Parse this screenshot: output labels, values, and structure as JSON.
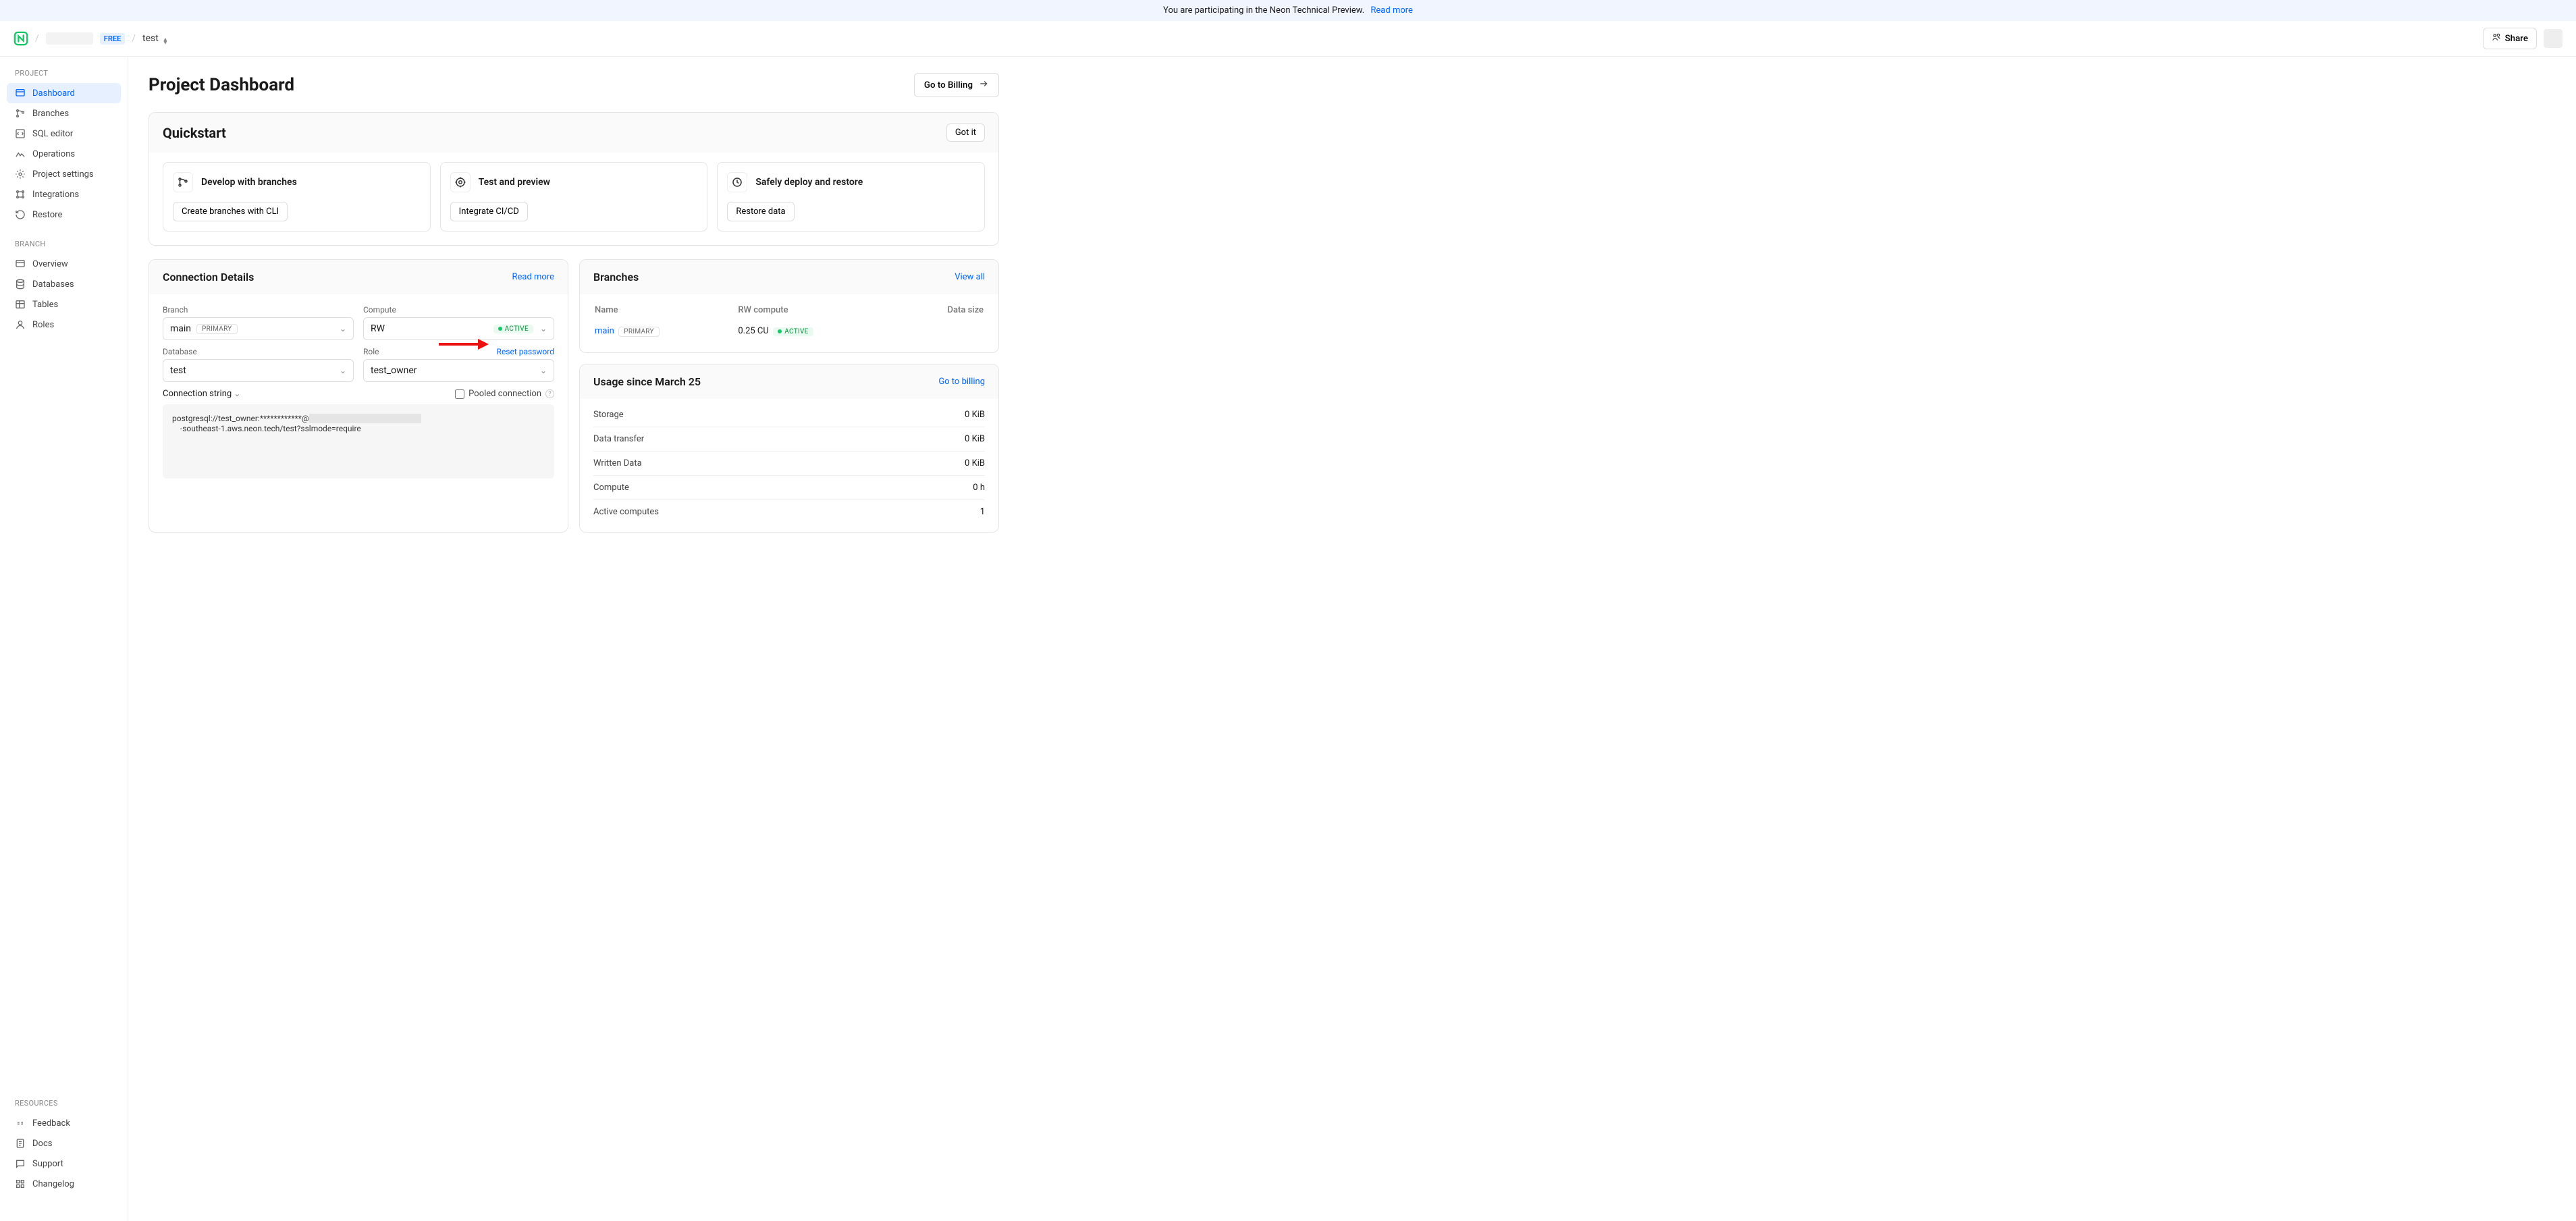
{
  "banner": {
    "text": "You are participating in the Neon Technical Preview.",
    "link": "Read more"
  },
  "topbar": {
    "free": "FREE",
    "project": "test",
    "share": "Share"
  },
  "sidebar": {
    "groups": {
      "project": {
        "label": "PROJECT",
        "items": [
          "Dashboard",
          "Branches",
          "SQL editor",
          "Operations",
          "Project settings",
          "Integrations",
          "Restore"
        ]
      },
      "branch": {
        "label": "BRANCH",
        "items": [
          "Overview",
          "Databases",
          "Tables",
          "Roles"
        ]
      },
      "resources": {
        "label": "RESOURCES",
        "items": [
          "Feedback",
          "Docs",
          "Support",
          "Changelog"
        ]
      }
    }
  },
  "page": {
    "title": "Project Dashboard",
    "billing_btn": "Go to Billing"
  },
  "quickstart": {
    "title": "Quickstart",
    "gotit": "Got it",
    "cards": [
      {
        "title": "Develop with branches",
        "btn": "Create branches with CLI"
      },
      {
        "title": "Test and preview",
        "btn": "Integrate CI/CD"
      },
      {
        "title": "Safely deploy and restore",
        "btn": "Restore data"
      }
    ]
  },
  "conn": {
    "title": "Connection Details",
    "read_more": "Read more",
    "labels": {
      "branch": "Branch",
      "compute": "Compute",
      "database": "Database",
      "role": "Role"
    },
    "branch": {
      "value": "main",
      "badge": "PRIMARY"
    },
    "compute": {
      "value": "RW",
      "badge": "ACTIVE"
    },
    "database": {
      "value": "test"
    },
    "role": {
      "value": "test_owner",
      "reset": "Reset password"
    },
    "cs_label": "Connection string",
    "pooled": "Pooled connection",
    "code_pre": "postgresql://test_owner:************@",
    "code_post": "\n    -southeast-1.aws.neon.tech/test?sslmode=require"
  },
  "branches": {
    "title": "Branches",
    "view_all": "View all",
    "cols": {
      "name": "Name",
      "rw": "RW compute",
      "size": "Data size"
    },
    "row": {
      "name": "main",
      "primary": "PRIMARY",
      "cu": "0.25 CU",
      "active": "ACTIVE"
    }
  },
  "usage": {
    "title": "Usage since March 25",
    "link": "Go to billing",
    "rows": [
      {
        "l": "Storage",
        "v": "0 KiB"
      },
      {
        "l": "Data transfer",
        "v": "0 KiB"
      },
      {
        "l": "Written Data",
        "v": "0 KiB"
      },
      {
        "l": "Compute",
        "v": "0 h"
      },
      {
        "l": "Active computes",
        "v": "1"
      }
    ]
  }
}
